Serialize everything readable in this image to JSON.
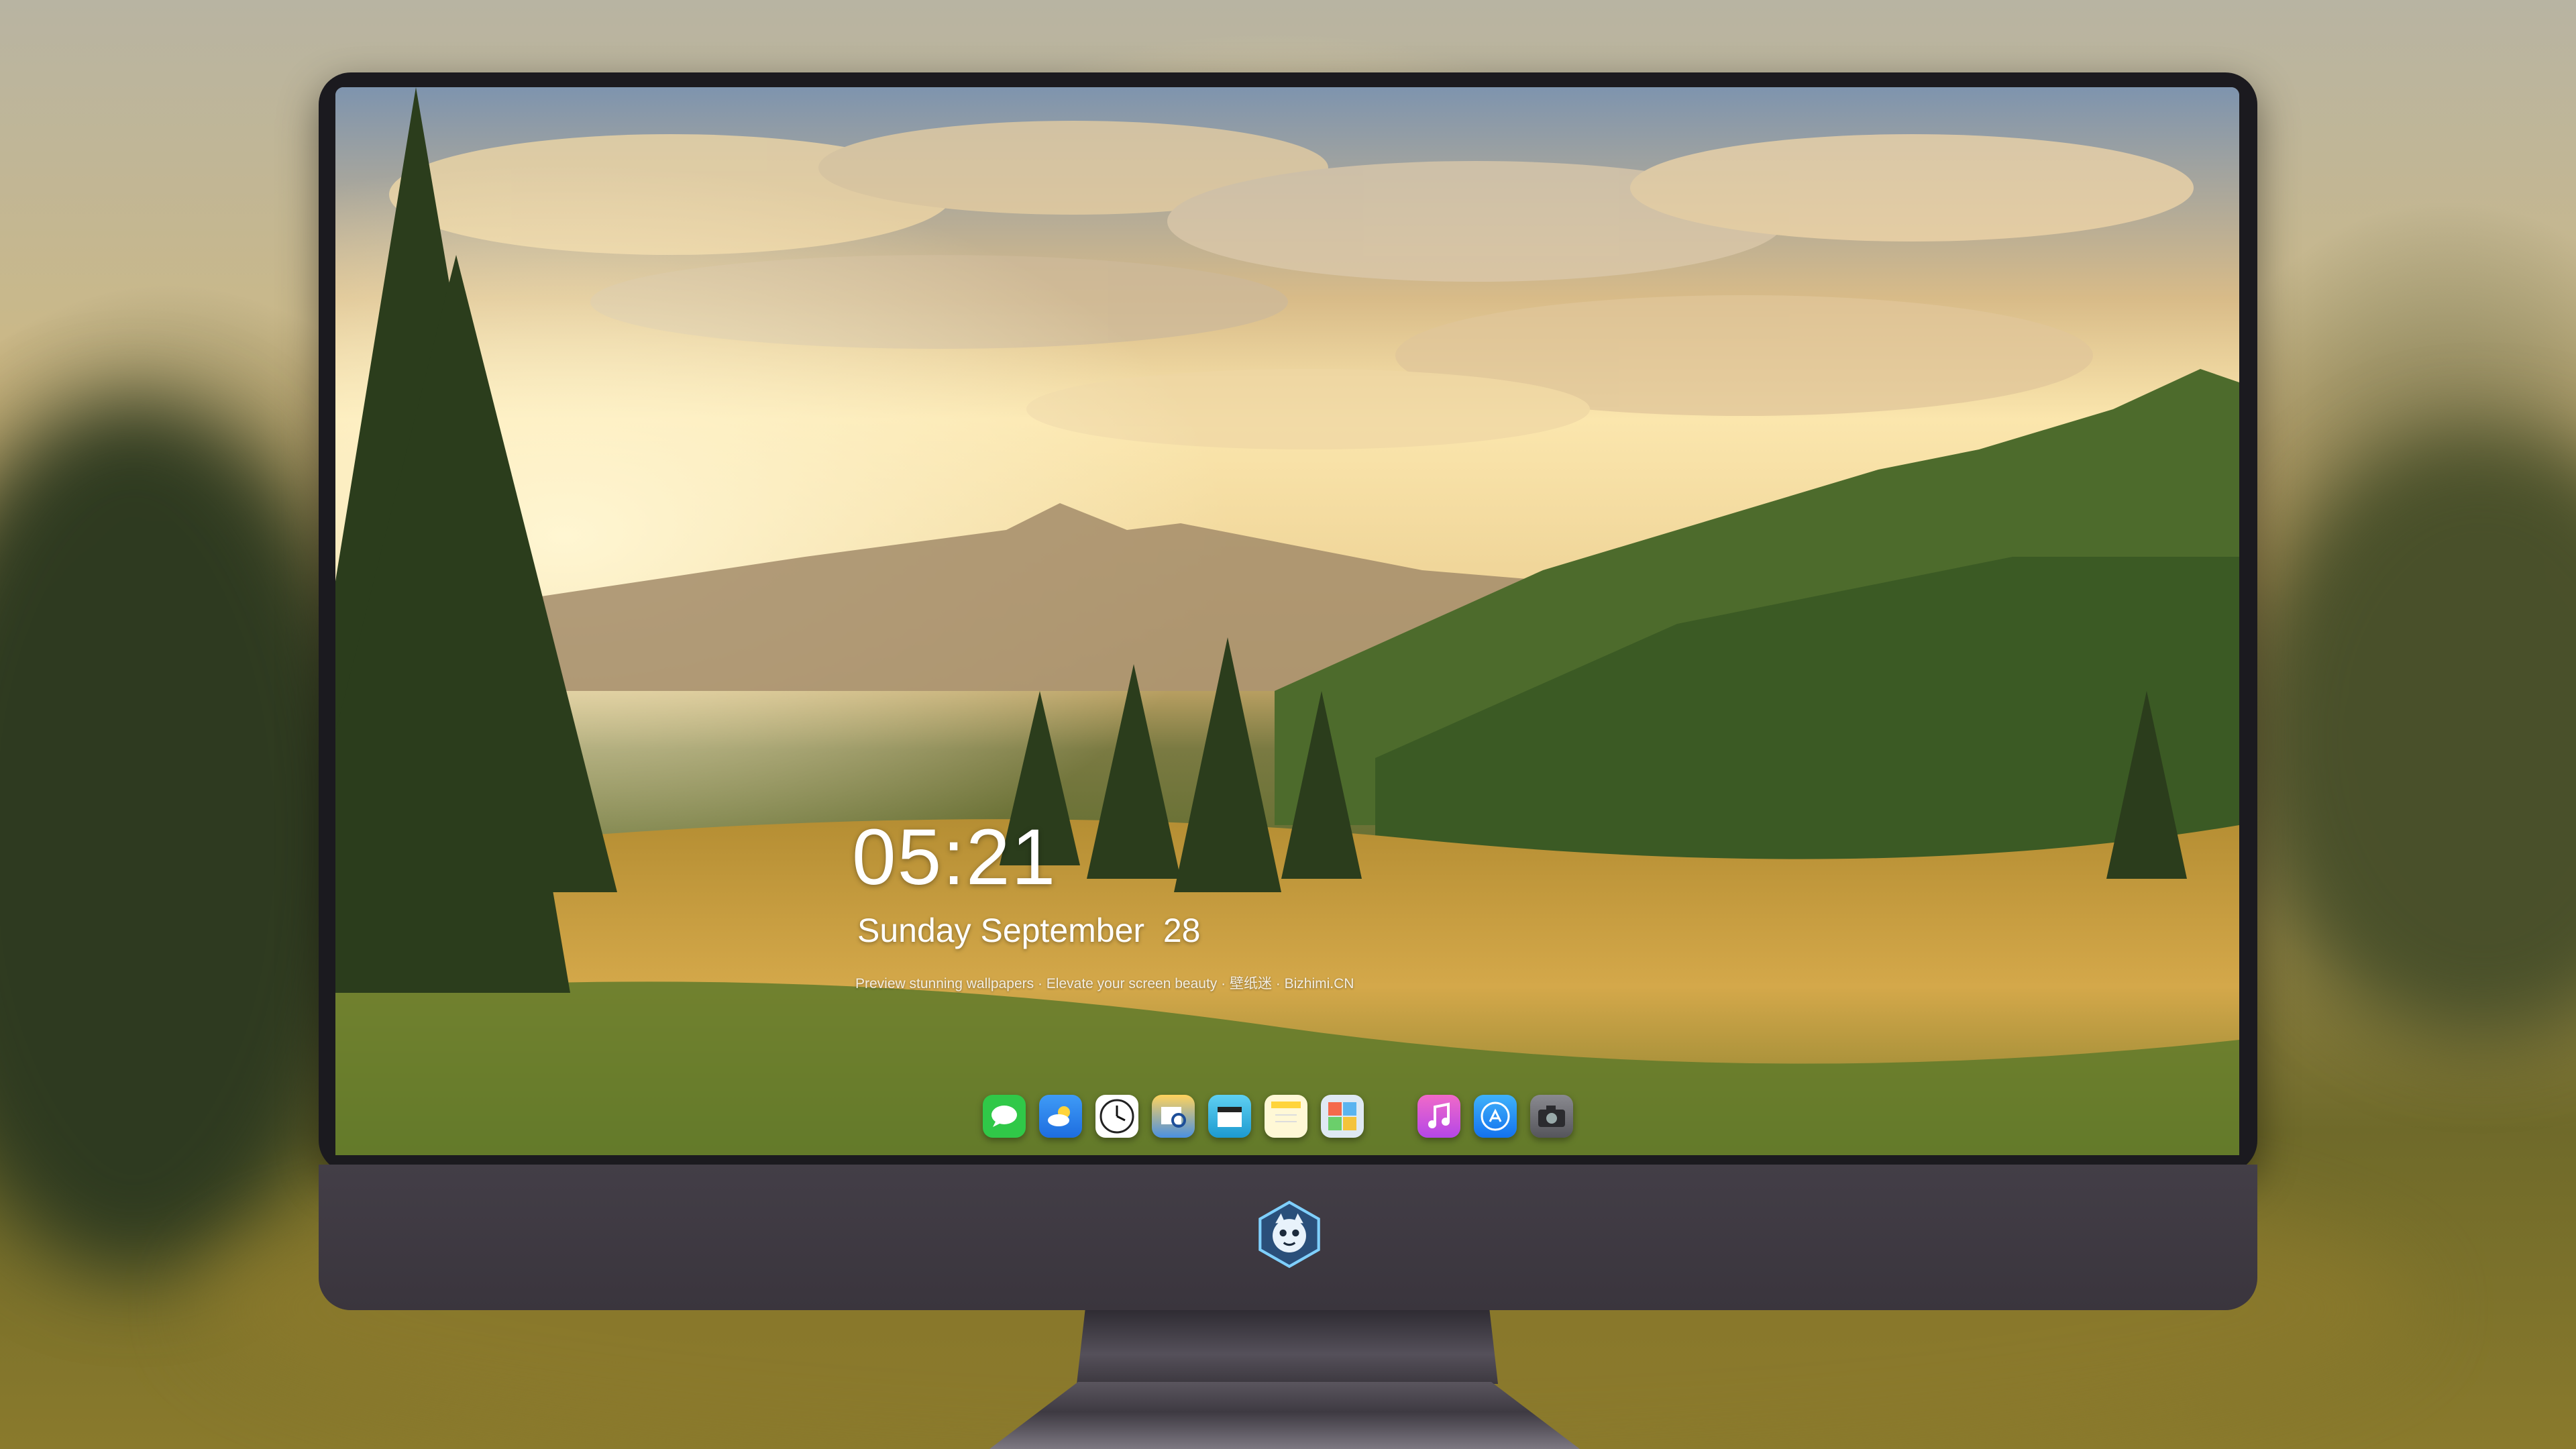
{
  "lock_screen": {
    "time": "05:21",
    "date": "Sunday September  28",
    "tagline": "Preview stunning wallpapers · Elevate your screen beauty · 壁纸迷 · Bizhimi.CN"
  },
  "dock": {
    "icons": [
      {
        "name": "messages-icon",
        "color": "#2fd14a"
      },
      {
        "name": "weather-icon",
        "color": "#2f8cf0"
      },
      {
        "name": "clock-icon",
        "color": "#ffffff"
      },
      {
        "name": "preview-icon",
        "color": "#4a90e2"
      },
      {
        "name": "video-clapper-icon",
        "color": "#3bb8e8"
      },
      {
        "name": "notes-icon",
        "color": "#ffd43b"
      },
      {
        "name": "photo-booth-icon",
        "color": "#5aa8e0"
      },
      {
        "name": "music-icon",
        "color": "#e74ec8"
      },
      {
        "name": "app-store-icon",
        "color": "#1f8ff5"
      },
      {
        "name": "camera-icon",
        "color": "#6b6b70"
      }
    ]
  },
  "monitor": {
    "logo": "mascot-logo-icon"
  }
}
